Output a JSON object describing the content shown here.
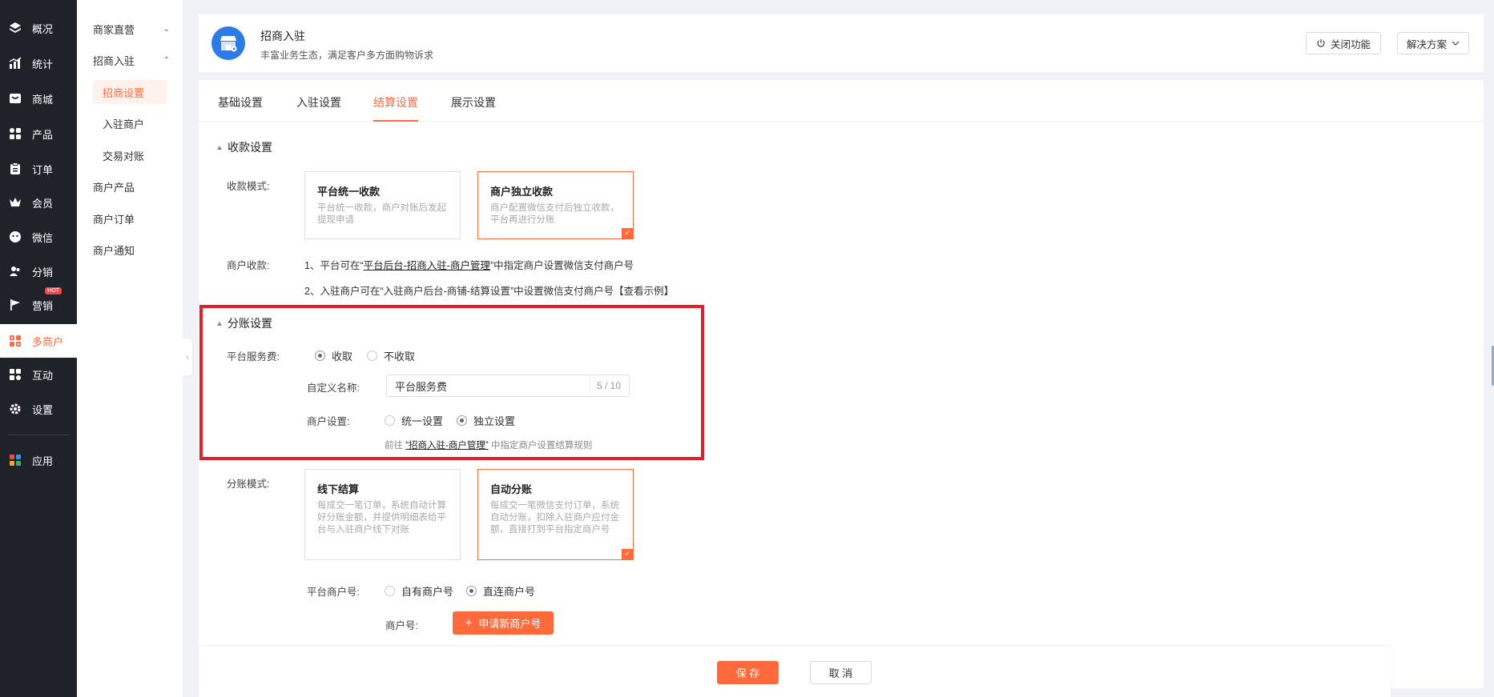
{
  "nav": {
    "items": [
      {
        "label": "概况",
        "icon": "layers-icon"
      },
      {
        "label": "统计",
        "icon": "chart-icon"
      },
      {
        "label": "商城",
        "icon": "store-icon"
      },
      {
        "label": "产品",
        "icon": "grid-icon"
      },
      {
        "label": "订单",
        "icon": "clipboard-icon"
      },
      {
        "label": "会员",
        "icon": "crown-icon"
      },
      {
        "label": "微信",
        "icon": "wechat-icon"
      },
      {
        "label": "分销",
        "icon": "users-icon"
      },
      {
        "label": "营销",
        "icon": "flag-icon",
        "badge": "HOT"
      },
      {
        "label": "多商户",
        "icon": "multi-shop-icon"
      },
      {
        "label": "互动",
        "icon": "interact-icon"
      },
      {
        "label": "设置",
        "icon": "gear-icon"
      },
      {
        "label": "应用",
        "icon": "apps-icon"
      }
    ],
    "active": "多商户"
  },
  "subnav": {
    "groups": [
      {
        "label": "商家直营"
      },
      {
        "label": "招商入驻",
        "children": [
          "招商设置",
          "入驻商户",
          "交易对账"
        ]
      },
      {
        "label": "商户产品"
      },
      {
        "label": "商户订单"
      },
      {
        "label": "商户通知"
      }
    ],
    "active": "招商设置"
  },
  "header": {
    "title": "招商入驻",
    "subtitle": "丰富业务生态，满足客户多方面购物诉求",
    "close_label": "关闭功能",
    "solution_label": "解决方案"
  },
  "tabs": [
    "基础设置",
    "入驻设置",
    "结算设置",
    "展示设置"
  ],
  "active_tab": "结算设置",
  "collection": {
    "section_title": "收款设置",
    "mode_label": "收款模式:",
    "options": [
      {
        "title": "平台统一收款",
        "desc": "平台统一收款，商户对账后发起提现申请",
        "selected": false
      },
      {
        "title": "商户独立收款",
        "desc": "商户配置微信支付后独立收款，平台再进行分账",
        "selected": true
      }
    ],
    "merchant_label": "商户收款:",
    "line1_prefix": "1、平台可在“",
    "line1_link": "平台后台-招商入驻-商户管理",
    "line1_suffix": "”中指定商户设置微信支付商户号",
    "line2": "2、入驻商户可在“入驻商户后台-商铺-结算设置”中设置微信支付商户号【查看示例】"
  },
  "split": {
    "section_title": "分账设置",
    "fee_label": "平台服务费:",
    "fee_options": [
      {
        "label": "收取",
        "checked": true
      },
      {
        "label": "不收取",
        "checked": false
      }
    ],
    "name_label": "自定义名称:",
    "name_value": "平台服务费",
    "name_count": "5 / 10",
    "merchant_setting_label": "商户设置:",
    "merchant_options": [
      {
        "label": "统一设置",
        "checked": false
      },
      {
        "label": "独立设置",
        "checked": true
      }
    ],
    "hint_prefix": "前往",
    "hint_link": "“招商入驻-商户管理”",
    "hint_suffix": "中指定商户设置结算规则",
    "mode_label": "分账模式:",
    "mode_options": [
      {
        "title": "线下结算",
        "desc": "每成交一笔订单，系统自动计算好分账金额，并提供明细表给平台与入驻商户线下对账",
        "selected": false
      },
      {
        "title": "自动分账",
        "desc": "每成交一笔微信支付订单，系统自动分账，扣除入驻商户应付金额，直接打到平台指定商户号",
        "selected": true
      }
    ],
    "platform_mch_label": "平台商户号:",
    "platform_mch_options": [
      {
        "label": "自有商户号",
        "checked": false
      },
      {
        "label": "直连商户号",
        "checked": true
      }
    ],
    "mch_no_label": "商户号:",
    "apply_button": "申请新商户号"
  },
  "footer": {
    "save": "保 存",
    "cancel": "取 消"
  },
  "colors": {
    "accent": "#ff6a3d",
    "sidebar": "#1f2229",
    "highlight_box": "#e0202a"
  }
}
